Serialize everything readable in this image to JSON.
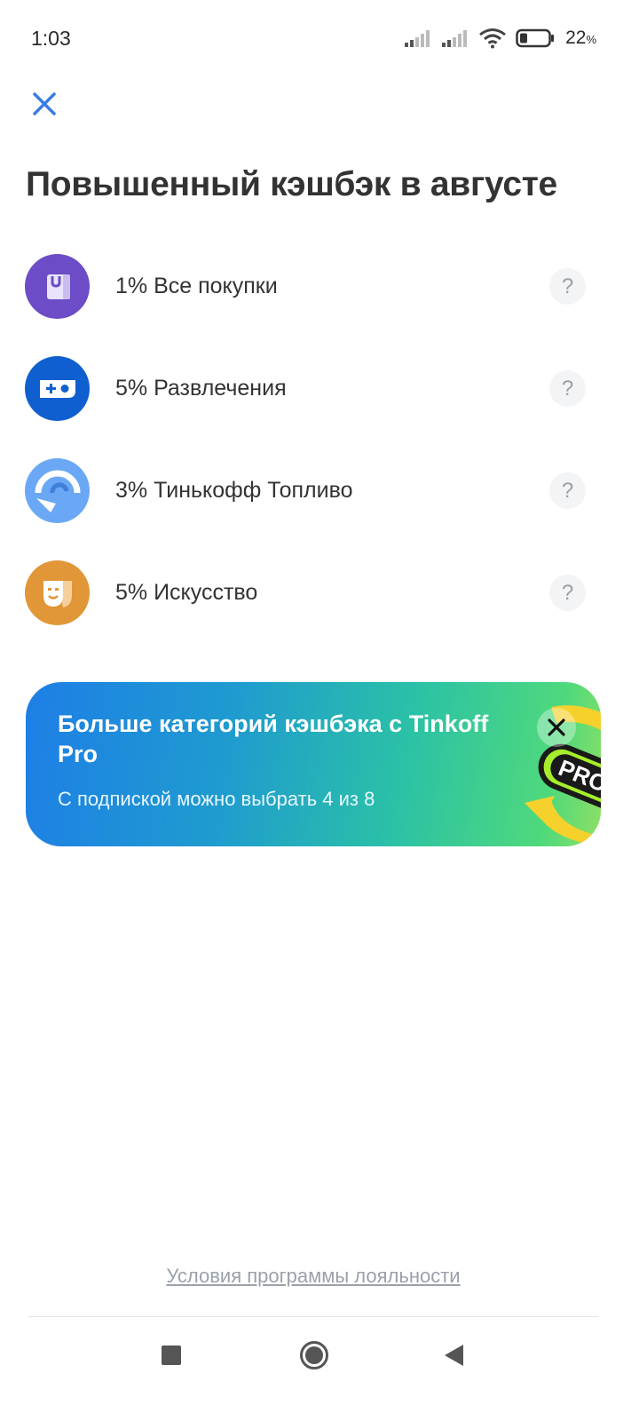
{
  "status_bar": {
    "time": "1:03",
    "battery_percent": "22",
    "battery_unit": "%",
    "icons": [
      "signal-icon",
      "signal-icon",
      "wifi-icon",
      "battery-icon"
    ]
  },
  "header": {
    "close_icon": "close-icon",
    "title": "Повышенный кэшбэк в августе"
  },
  "categories": [
    {
      "label": "1% Все покупки",
      "icon": "shopping-bag-icon",
      "color": "#6c4cc7",
      "help": "?"
    },
    {
      "label": "5% Развлечения",
      "icon": "gamepad-icon",
      "color": "#0f5fd0",
      "help": "?"
    },
    {
      "label": "3% Тинькофф Топливо",
      "icon": "fuel-gauge-icon",
      "color": "#6aa8f5",
      "help": "?"
    },
    {
      "label": "5% Искусство",
      "icon": "theater-mask-icon",
      "color": "#e19638",
      "help": "?"
    }
  ],
  "promo": {
    "title": "Больше категорий кэшбэка с Tinkoff Pro",
    "subtitle": "С подпиской можно выбрать 4 из 8",
    "badge_text": "PRO"
  },
  "footer": {
    "loyalty_link": "Условия программы лояльности"
  },
  "nav_bar": {
    "items": [
      "recents-square-icon",
      "home-circle-icon",
      "back-triangle-icon"
    ]
  },
  "colors": {
    "accent": "#3a7ce3",
    "title_text": "#333333",
    "link_gray": "#9aa1ab"
  }
}
